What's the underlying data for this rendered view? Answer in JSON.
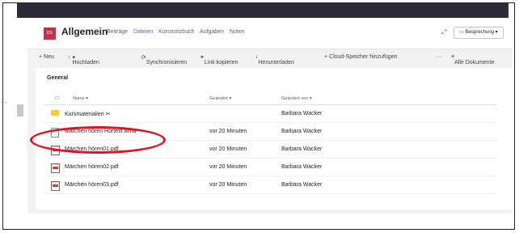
{
  "header": {
    "team_avatar": "DS",
    "team_name": "Allgemein",
    "tabs": [
      "Beiträge",
      "Dateien",
      "Kursnotizbuch",
      "Aufgaben",
      "Noten"
    ],
    "meeting_button": "Besprechung"
  },
  "toolbar": {
    "new": "+ Neu",
    "upload": "Hochladen",
    "sync": "Synchronisieren",
    "copy_link": "Link kopieren",
    "download": "Herunterladen",
    "cloud": "+ Cloud-Speicher hinzufügen",
    "more": "···",
    "all_docs": "Alle Dokumente"
  },
  "section_title": "General",
  "columns": {
    "name": "Name",
    "modified": "Geändert",
    "modified_by": "Geändert von"
  },
  "files": [
    {
      "name": "Kursmaterialien",
      "modified": "",
      "modified_by": "Barbara Wacker",
      "icon": "folder-icon"
    },
    {
      "name": "Märchen hören Hörtext.wma",
      "modified": "vor 20 Minuten",
      "modified_by": "Barbara Wacker",
      "icon": "audio-file-icon"
    },
    {
      "name": "Märchen hören01.pdf",
      "modified": "vor 20 Minuten",
      "modified_by": "Barbara Wacker",
      "icon": "pdf-icon"
    },
    {
      "name": "Märchen hören02.pdf",
      "modified": "vor 20 Minuten",
      "modified_by": "Barbara Wacker",
      "icon": "pdf-icon"
    },
    {
      "name": "Märchen hören03.pdf",
      "modified": "vor 20 Minuten",
      "modified_by": "Barbara Wacker",
      "icon": "pdf-icon"
    }
  ],
  "colors": {
    "accent": "#6264a7",
    "highlight": "#e0141e",
    "avatar": "#c4314b"
  }
}
